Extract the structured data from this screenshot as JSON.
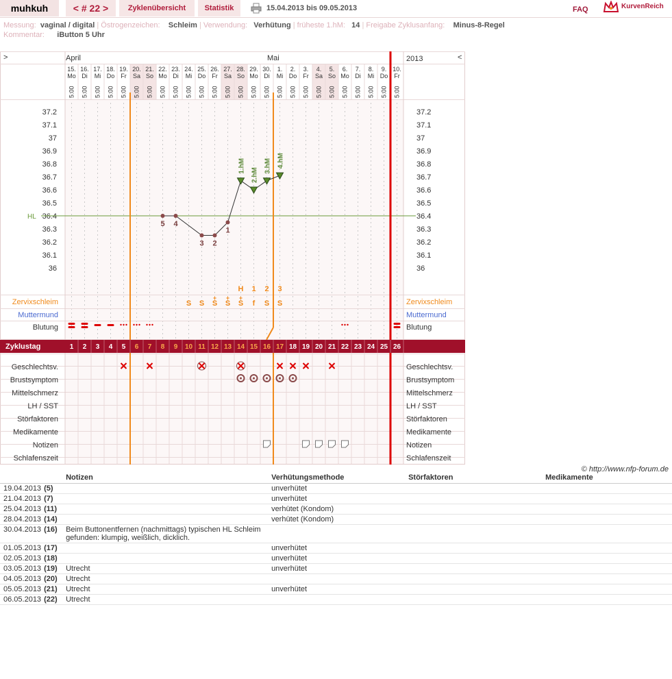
{
  "header": {
    "user": "muhkuh",
    "cycle_nav": "< # 22 >",
    "tab_overview": "Zyklenübersicht",
    "tab_stats": "Statistik",
    "date_range": "15.04.2013 bis 09.05.2013",
    "faq": "FAQ",
    "logo": "KurvenReich"
  },
  "info": {
    "measurement_label": "Messung:",
    "measurement": "vaginal / digital",
    "estrogen_label": "Östrogenzeichen:",
    "estrogen": "Schleim",
    "usage_label": "Verwendung:",
    "usage": "Verhütung",
    "earliest_label": "früheste 1.hM:",
    "earliest": "14",
    "release_label": "Freigabe Zyklusanfang:",
    "release": "Minus-8-Regel",
    "comment_label": "Kommentar:",
    "comment": "iButton 5 Uhr"
  },
  "chart_data": {
    "type": "line",
    "months": [
      "April",
      "Mai"
    ],
    "year": "2013",
    "nav_left": ">",
    "nav_right": "<",
    "days": [
      {
        "d": "15.",
        "w": "Mo",
        "t": "5:00"
      },
      {
        "d": "16.",
        "w": "Di",
        "t": "5:00"
      },
      {
        "d": "17.",
        "w": "Mi",
        "t": "5:00"
      },
      {
        "d": "18.",
        "w": "Do",
        "t": "5:00"
      },
      {
        "d": "19.",
        "w": "Fr",
        "t": "5:00"
      },
      {
        "d": "20.",
        "w": "Sa",
        "t": "5:00"
      },
      {
        "d": "21.",
        "w": "So",
        "t": "5:00"
      },
      {
        "d": "22.",
        "w": "Mo",
        "t": "5:00"
      },
      {
        "d": "23.",
        "w": "Di",
        "t": "5:00"
      },
      {
        "d": "24.",
        "w": "Mi",
        "t": "5:00"
      },
      {
        "d": "25.",
        "w": "Do",
        "t": "5:00"
      },
      {
        "d": "26.",
        "w": "Fr",
        "t": "5:00"
      },
      {
        "d": "27.",
        "w": "Sa",
        "t": "5:00"
      },
      {
        "d": "28.",
        "w": "So",
        "t": "5:00"
      },
      {
        "d": "29.",
        "w": "Mo",
        "t": "5:00"
      },
      {
        "d": "30.",
        "w": "Di",
        "t": "5:00"
      },
      {
        "d": "1.",
        "w": "Mi",
        "t": "5:00"
      },
      {
        "d": "2.",
        "w": "Do",
        "t": "5:00"
      },
      {
        "d": "3.",
        "w": "Fr",
        "t": "5:00"
      },
      {
        "d": "4.",
        "w": "Sa",
        "t": "5:00"
      },
      {
        "d": "5.",
        "w": "So",
        "t": "5:00"
      },
      {
        "d": "6.",
        "w": "Mo",
        "t": "5:00"
      },
      {
        "d": "7.",
        "w": "Di",
        "t": "5:00"
      },
      {
        "d": "8.",
        "w": "Mi",
        "t": "5:00"
      },
      {
        "d": "9.",
        "w": "Do",
        "t": "5:00"
      },
      {
        "d": "10.",
        "w": "Fr",
        "t": "5:00"
      }
    ],
    "weekend_days": [
      6,
      7,
      13,
      14,
      20,
      21
    ],
    "y_ticks": [
      "37.2",
      "37.1",
      "37",
      "36.9",
      "36.8",
      "36.7",
      "36.6",
      "36.5",
      "36.4",
      "36.3",
      "36.2",
      "36.1",
      "36"
    ],
    "ylim": [
      36.0,
      37.2
    ],
    "hl_value": 36.4,
    "hl_label": "HL",
    "cover_line_days": [
      6,
      17
    ],
    "today_day": 25,
    "temperatures": [
      {
        "day": 8,
        "v": 36.4,
        "label": "5"
      },
      {
        "day": 9,
        "v": 36.4,
        "label": "4"
      },
      {
        "day": 11,
        "v": 36.25,
        "label": "3"
      },
      {
        "day": 12,
        "v": 36.25,
        "label": "2"
      },
      {
        "day": 13,
        "v": 36.35,
        "label": "1"
      },
      {
        "day": 14,
        "v": 36.67,
        "label": "1.hM",
        "high": true
      },
      {
        "day": 15,
        "v": 36.6,
        "label": "2.hM",
        "high": true
      },
      {
        "day": 16,
        "v": 36.67,
        "label": "3.hM",
        "high": true
      },
      {
        "day": 17,
        "v": 36.71,
        "label": "4.hM",
        "high": true
      }
    ],
    "peak_markers": [
      {
        "day": 14,
        "t": "H"
      },
      {
        "day": 15,
        "t": "1"
      },
      {
        "day": 16,
        "t": "2"
      },
      {
        "day": 17,
        "t": "3"
      }
    ],
    "mucus": [
      {
        "day": 10,
        "t": "S"
      },
      {
        "day": 11,
        "t": "S"
      },
      {
        "day": 12,
        "t": "S+"
      },
      {
        "day": 13,
        "t": "S+"
      },
      {
        "day": 14,
        "t": "S+"
      },
      {
        "day": 15,
        "t": "f"
      },
      {
        "day": 16,
        "t": "S"
      },
      {
        "day": 17,
        "t": "S"
      }
    ],
    "bleeding": [
      {
        "day": 1,
        "t": "heavy"
      },
      {
        "day": 2,
        "t": "heavy"
      },
      {
        "day": 3,
        "t": "medium"
      },
      {
        "day": 4,
        "t": "medium"
      },
      {
        "day": 5,
        "t": "dots"
      },
      {
        "day": 6,
        "t": "dots"
      },
      {
        "day": 7,
        "t": "dots"
      },
      {
        "day": 22,
        "t": "dots"
      },
      {
        "day": 26,
        "t": "heavy"
      }
    ],
    "sex": [
      {
        "day": 5,
        "t": "x"
      },
      {
        "day": 7,
        "t": "x"
      },
      {
        "day": 11,
        "t": "xp"
      },
      {
        "day": 14,
        "t": "xp"
      },
      {
        "day": 17,
        "t": "x"
      },
      {
        "day": 18,
        "t": "x"
      },
      {
        "day": 19,
        "t": "x"
      },
      {
        "day": 21,
        "t": "x"
      }
    ],
    "breast": [
      14,
      15,
      16,
      17,
      18
    ],
    "notes_icons": [
      16,
      19,
      20,
      21,
      22
    ],
    "row_labels": {
      "mucus": "Zervixschleim",
      "cervix": "Muttermund",
      "bleeding": "Blutung",
      "cycle_day": "Zyklustag",
      "sex": "Geschlechtsv.",
      "breast": "Brustsymptom",
      "midpain": "Mittelschmerz",
      "lh": "LH / SST",
      "disturb": "Störfaktoren",
      "meds": "Medikamente",
      "notes": "Notizen",
      "sleep": "Schlafenszeit"
    },
    "colors": {
      "orange": "#f08a1c",
      "red": "#c8102e",
      "cycle_band": "#a0102a",
      "green": "#5d8a3a",
      "temp_line": "#333",
      "dot": "#8b4a4a",
      "triangle": "#5a8a2a"
    }
  },
  "copyright": "© http://www.nfp-forum.de",
  "notes_table": {
    "headers": [
      "Notizen",
      "Verhütungsmethode",
      "Störfaktoren",
      "Medikamente"
    ],
    "rows": [
      {
        "date": "19.04.2013",
        "cycle": "(5)",
        "note": "",
        "method": "unverhütet"
      },
      {
        "date": "21.04.2013",
        "cycle": "(7)",
        "note": "",
        "method": "unverhütet"
      },
      {
        "date": "25.04.2013",
        "cycle": "(11)",
        "note": "",
        "method": "verhütet (Kondom)"
      },
      {
        "date": "28.04.2013",
        "cycle": "(14)",
        "note": "",
        "method": "verhütet (Kondom)"
      },
      {
        "date": "30.04.2013",
        "cycle": "(16)",
        "note": "Beim Buttonentfernen (nachmittags) typischen HL Schleim gefunden: klumpig, weißlich, dicklich.",
        "method": ""
      },
      {
        "date": "01.05.2013",
        "cycle": "(17)",
        "note": "",
        "method": "unverhütet"
      },
      {
        "date": "02.05.2013",
        "cycle": "(18)",
        "note": "",
        "method": "unverhütet"
      },
      {
        "date": "03.05.2013",
        "cycle": "(19)",
        "note": "Utrecht",
        "method": "unverhütet"
      },
      {
        "date": "04.05.2013",
        "cycle": "(20)",
        "note": "Utrecht",
        "method": ""
      },
      {
        "date": "05.05.2013",
        "cycle": "(21)",
        "note": "Utrecht",
        "method": "unverhütet"
      },
      {
        "date": "06.05.2013",
        "cycle": "(22)",
        "note": "Utrecht",
        "method": ""
      }
    ]
  }
}
